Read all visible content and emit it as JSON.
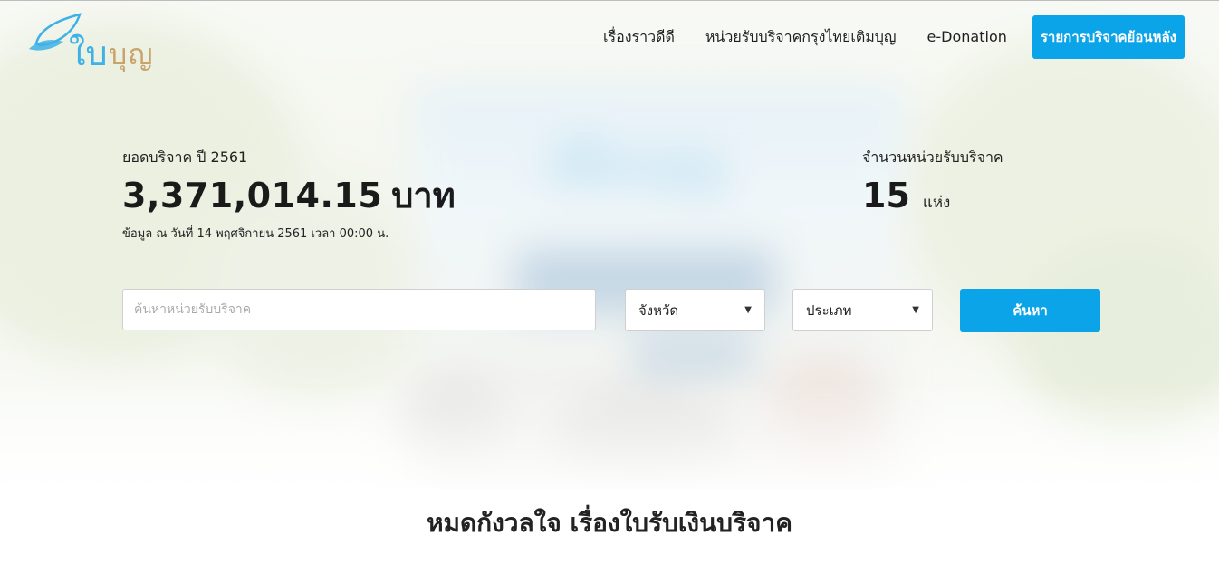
{
  "logo": {
    "text_blue": "ใบ",
    "text_gold": "บุญ",
    "leaf_icon": "leaf-icon"
  },
  "nav": {
    "items": [
      {
        "label": "เรื่องราวดีดี"
      },
      {
        "label": "หน่วยรับบริจาคกรุงไทยเติมบุญ"
      },
      {
        "label": "e-Donation"
      }
    ],
    "cta_label": "รายการบริจาคย้อนหลัง"
  },
  "stats": {
    "donation_label": "ยอดบริจาค ปี 2561",
    "donation_amount": "3,371,014.15",
    "donation_unit": "บาท",
    "data_note": "ข้อมูล ณ วันที่ 14 พฤศจิกายน 2561 เวลา 00:00 น.",
    "units_label": "จำนวนหน่วยรับบริจาค",
    "units_count": "15",
    "units_unit": "แห่ง"
  },
  "search": {
    "placeholder": "ค้นหาหน่วยรับบริจาค",
    "province_value": "จังหวัด",
    "type_value": "ประเภท",
    "button_label": "ค้นหา"
  },
  "section": {
    "heading": "หมดกังวลใจ เรื่องใบรับเงินบริจาค"
  },
  "colors": {
    "accent": "#0ba4e8",
    "logo_blue": "#3db2e6",
    "logo_gold": "#c9a46a"
  }
}
